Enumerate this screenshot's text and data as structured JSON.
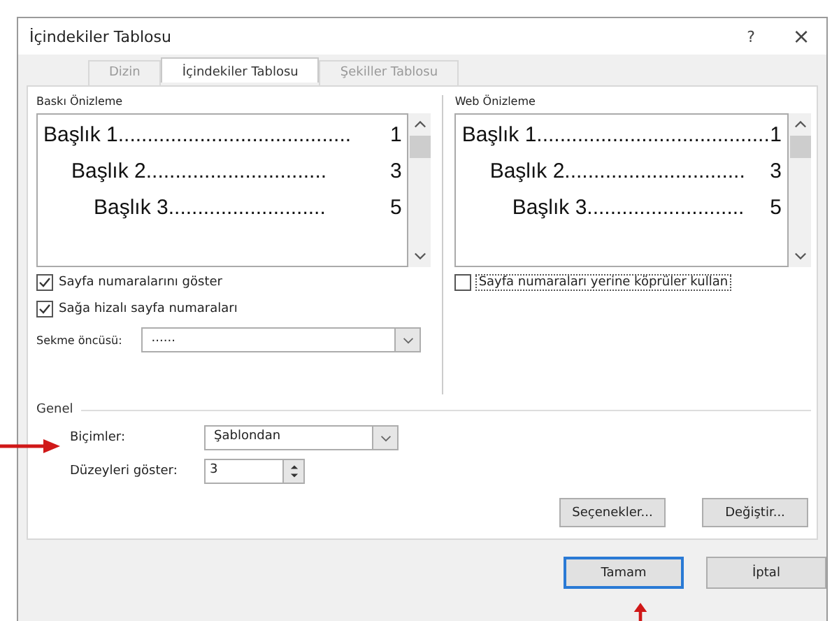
{
  "window": {
    "title": "İçindekiler Tablosu",
    "help": "?",
    "close": "×"
  },
  "tabs": [
    {
      "label": "Dizin",
      "selected": false,
      "disabled": true
    },
    {
      "label": "İçindekiler Tablosu",
      "selected": true,
      "disabled": false
    },
    {
      "label": "Şekiller Tablosu",
      "selected": false,
      "disabled": true
    }
  ],
  "print_preview": {
    "label": "Baskı Önizleme",
    "entries": [
      {
        "title": "Başlık 1",
        "leader": "........................................",
        "page": "1"
      },
      {
        "title": "Başlık 2",
        "leader": "...............................",
        "page": "3"
      },
      {
        "title": "Başlık 3",
        "leader": "...........................",
        "page": "5"
      }
    ]
  },
  "web_preview": {
    "label": "Web Önizleme",
    "entries": [
      {
        "title": "Başlık 1",
        "leader": "........................................",
        "page": "1"
      },
      {
        "title": "Başlık 2",
        "leader": "...............................",
        "page": "3"
      },
      {
        "title": "Başlık 3",
        "leader": "...........................",
        "page": "5"
      }
    ]
  },
  "print_options": [
    {
      "label": "Sayfa numaralarını göster",
      "checked": true
    },
    {
      "label": "Sağa hizalı sayfa numaraları",
      "checked": true
    }
  ],
  "tab_leader": {
    "label": "Sekme öncüsü:",
    "value": "......"
  },
  "web_options": [
    {
      "label": "Sayfa numaraları yerine köprüler kullan",
      "checked": false
    }
  ],
  "general": {
    "label": "Genel",
    "formats": {
      "label": "Biçimler:",
      "value": "Şablondan"
    },
    "levels": {
      "label": "Düzeyleri göster:",
      "value": "3"
    }
  },
  "action_buttons": [
    "Seçenekler...",
    "Değiştir..."
  ],
  "dialog_buttons": [
    {
      "label": "Tamam",
      "default": true
    },
    {
      "label": "İptal",
      "default": false
    }
  ]
}
